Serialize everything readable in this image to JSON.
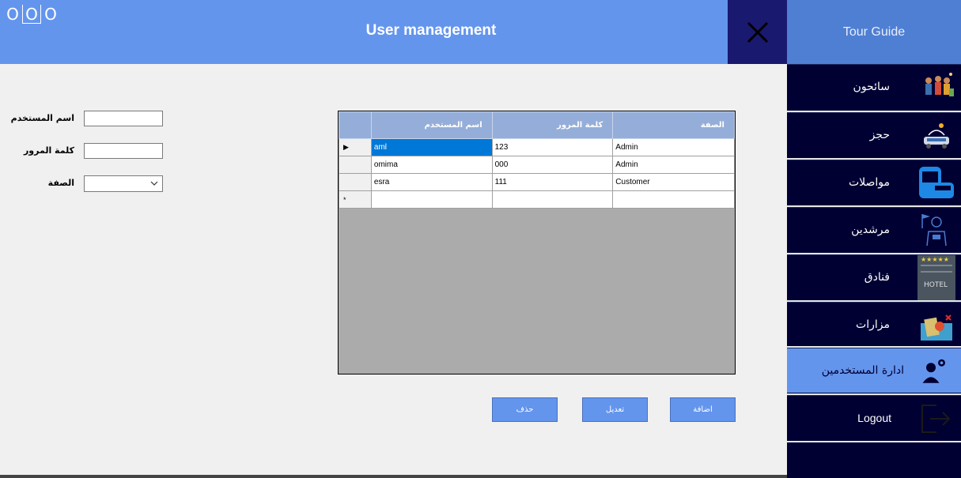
{
  "window": {
    "controls": [
      "O",
      "O",
      "O"
    ],
    "title": "User management"
  },
  "sidebar": {
    "header": "Tour Guide",
    "items": [
      {
        "label": "سائحون",
        "icon": "tourists-icon"
      },
      {
        "label": "حجز",
        "icon": "booking-icon"
      },
      {
        "label": "مواصلات",
        "icon": "bus-icon"
      },
      {
        "label": "مرشدين",
        "icon": "guide-icon"
      },
      {
        "label": "فنادق",
        "icon": "hotel-icon"
      },
      {
        "label": "مزارات",
        "icon": "sights-icon"
      },
      {
        "label": "ادارة المستخدمين",
        "icon": "user-settings-icon",
        "active": true
      },
      {
        "label": "Logout",
        "icon": "logout-icon"
      }
    ]
  },
  "form": {
    "username_label": "اسم المستخدم",
    "username_value": "",
    "password_label": "كلمة المرور",
    "password_value": "",
    "role_label": "الصفة",
    "role_value": ""
  },
  "grid": {
    "columns": [
      "اسم المستخدم",
      "كلمة المرور",
      "الصفة"
    ],
    "rows": [
      {
        "marker": "▶",
        "cells": [
          "aml",
          "123",
          "Admin"
        ]
      },
      {
        "marker": "",
        "cells": [
          "omima",
          "000",
          "Admin"
        ]
      },
      {
        "marker": "",
        "cells": [
          "esra",
          "111",
          "Customer"
        ]
      },
      {
        "marker": "*",
        "cells": [
          "",
          "",
          ""
        ]
      }
    ],
    "selected_cell": "aml"
  },
  "buttons": {
    "delete": "حذف",
    "edit": "تعديل",
    "add": "اضافة"
  },
  "colors": {
    "accent": "#6495ed",
    "sidebar": "#000033",
    "close": "#191970",
    "grid_bg": "#ababab"
  }
}
